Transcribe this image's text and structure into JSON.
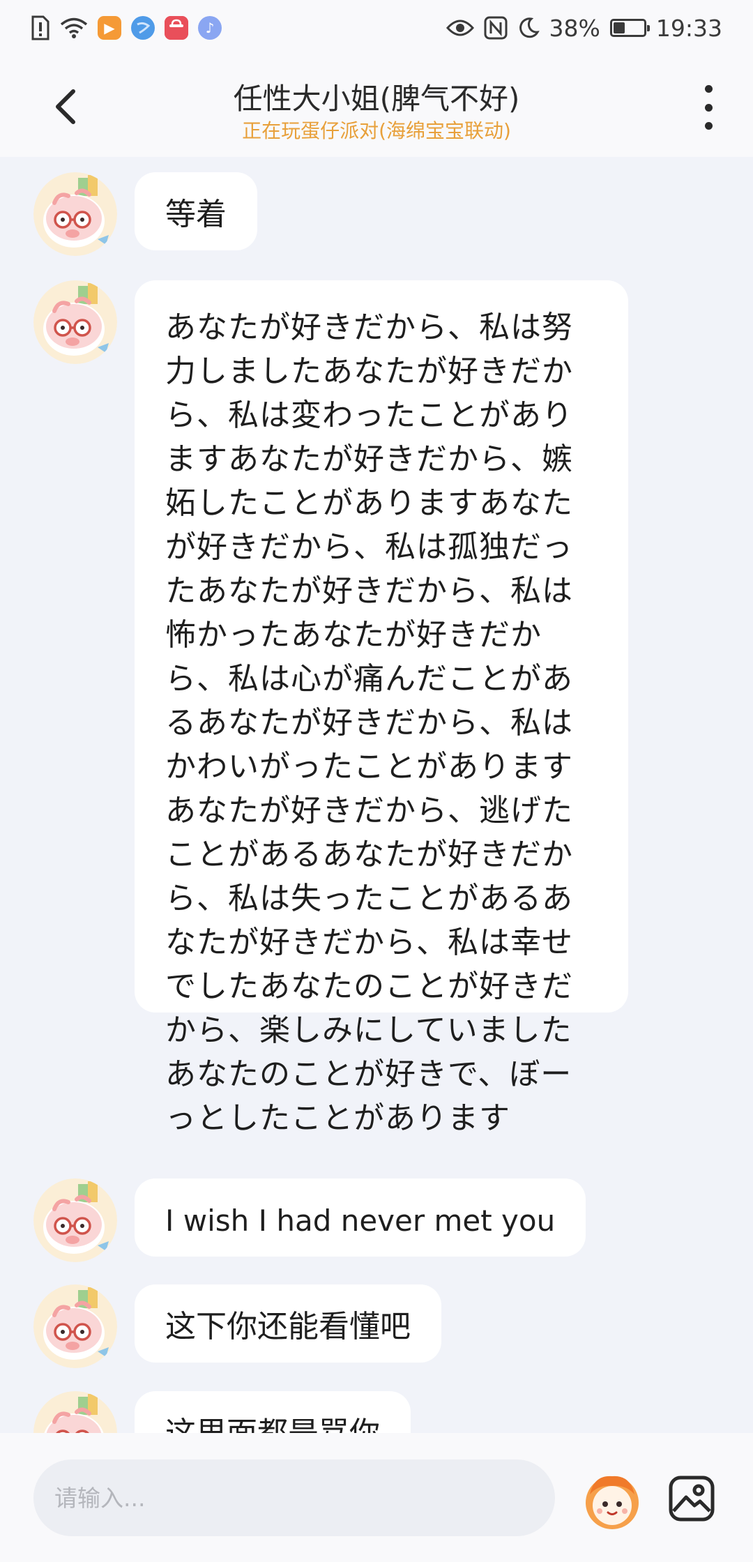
{
  "status_bar": {
    "battery_text": "38%",
    "battery_level": 0.38,
    "time": "19:33",
    "icons": [
      "alert-icon",
      "wifi-icon",
      "video-app-icon",
      "browser-app-icon",
      "shop-app-icon",
      "music-app-icon",
      "eye-icon",
      "nfc-icon",
      "moon-icon",
      "battery-icon"
    ]
  },
  "header": {
    "title": "任性大小姐(脾气不好)",
    "subtitle": "正在玩蛋仔派对(海绵宝宝联动)",
    "back_icon": "chevron-left-icon",
    "more_icon": "more-vertical-icon"
  },
  "messages": [
    {
      "text": "等着"
    },
    {
      "text": "あなたが好きだから、私は努力しましたあなたが好きだから、私は変わったことがありますあなたが好きだから、嫉妬したことがありますあなたが好きだから、私は孤独だったあなたが好きだから、私は怖かったあなたが好きだから、私は心が痛んだことがあるあなたが好きだから、私はかわいがったことがありますあなたが好きだから、逃げたことがあるあなたが好きだから、私は失ったことがあるあなたが好きだから、私は幸せでしたあなたのことが好きだから、楽しみにしていましたあなたのことが好きで、ぼーっとしたことがあります"
    },
    {
      "text": "I wish I had never met you"
    },
    {
      "text": "这下你还能看懂吧"
    },
    {
      "text": "这里面都是骂你"
    }
  ],
  "input": {
    "placeholder": "请输入..."
  },
  "colors": {
    "background": "#f1f3f9",
    "bubble": "#ffffff",
    "subtitle": "#e8a03a",
    "avatar_pink": "#f4a3a3"
  }
}
